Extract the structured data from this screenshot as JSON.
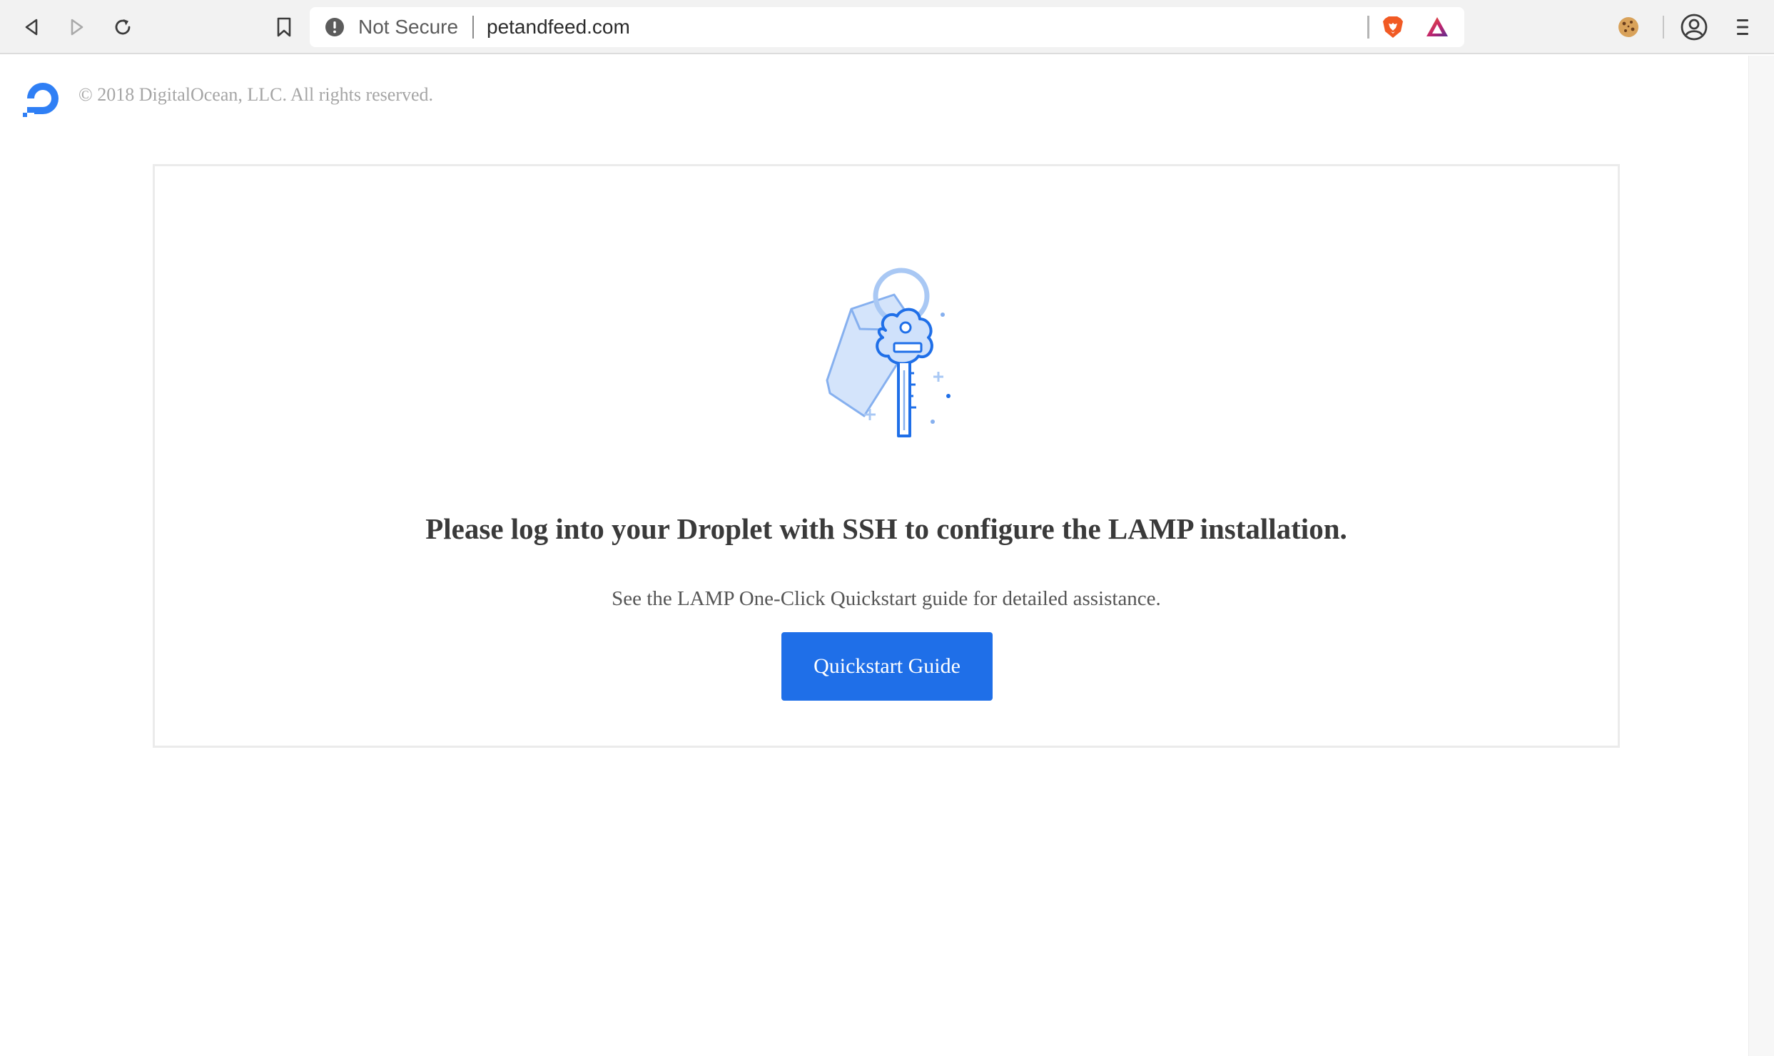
{
  "browser": {
    "nav": {
      "back_icon": "back-arrow-icon",
      "forward_icon": "forward-arrow-icon",
      "reload_icon": "reload-icon",
      "bookmark_icon": "bookmark-icon"
    },
    "address_bar": {
      "security_icon": "warning-circle-icon",
      "security_label": "Not Secure",
      "url": "petandfeed.com",
      "brave_shields_icon": "brave-lion-icon",
      "brave_rewards_icon": "brave-rewards-triangle-icon"
    },
    "extensions": {
      "cookie_icon": "cookie-icon"
    },
    "profile_icon": "profile-icon",
    "menu_icon": "hamburger-menu-icon"
  },
  "page": {
    "header": {
      "logo": "digitalocean-logo",
      "copyright": "© 2018 DigitalOcean, LLC. All rights reserved."
    },
    "card": {
      "illustration": "key-illustration",
      "heading": "Please log into your Droplet with SSH to configure the LAMP installation.",
      "subtext": "See the LAMP One-Click Quickstart guide for detailed assistance.",
      "button_label": "Quickstart Guide"
    }
  },
  "colors": {
    "accent": "#1f6fe8",
    "brand_blue": "#0069ff",
    "heading": "#3a3a3a",
    "muted": "#a5a5a5"
  }
}
